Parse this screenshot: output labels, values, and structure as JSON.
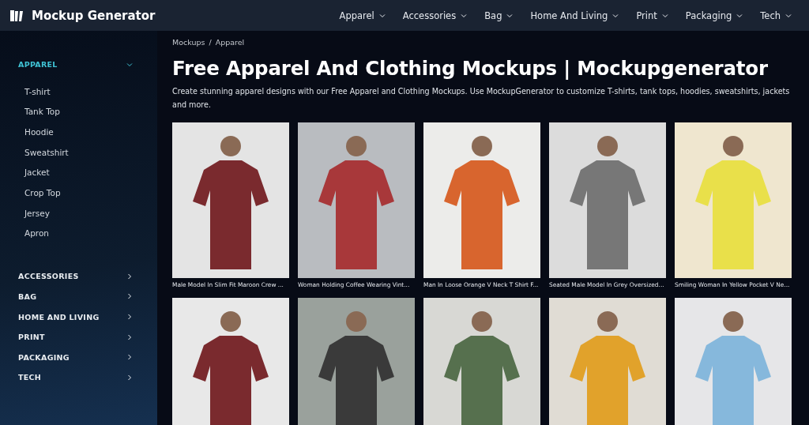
{
  "header": {
    "logo": "Mockup Generator",
    "nav": [
      "Apparel",
      "Accessories",
      "Bag",
      "Home And Living",
      "Print",
      "Packaging",
      "Tech"
    ]
  },
  "sidebar": {
    "categories": [
      {
        "label": "APPAREL",
        "expanded": true,
        "children": [
          {
            "label": "T-shirt"
          },
          {
            "label": "Tank Top"
          },
          {
            "label": "Hoodie"
          },
          {
            "label": "Sweatshirt"
          },
          {
            "label": "Jacket"
          },
          {
            "label": "Crop Top"
          },
          {
            "label": "Jersey"
          },
          {
            "label": "Apron"
          }
        ]
      },
      {
        "label": "ACCESSORIES",
        "expanded": false
      },
      {
        "label": "BAG",
        "expanded": false
      },
      {
        "label": "HOME AND LIVING",
        "expanded": false
      },
      {
        "label": "PRINT",
        "expanded": false
      },
      {
        "label": "PACKAGING",
        "expanded": false
      },
      {
        "label": "TECH",
        "expanded": false
      }
    ]
  },
  "breadcrumb": {
    "separator": "/",
    "items": [
      "Mockups",
      "Apparel"
    ]
  },
  "title": "Free Apparel And Clothing Mockups | Mockupgenerator",
  "description": "Create stunning apparel designs with our Free Apparel and Clothing Mockups. Use MockupGenerator to customize T-shirts, tank tops, hoodies, sweatshirts, jackets and more.",
  "mockups": [
    {
      "kind": "photo",
      "caption": "Male Model In Slim Fit Maroon Crew ..."
    },
    {
      "kind": "photo",
      "caption": "Woman Holding Coffee Wearing Vint..."
    },
    {
      "kind": "photo",
      "caption": "Man In Loose Orange V Neck T Shirt F..."
    },
    {
      "kind": "photo",
      "caption": "Seated Male Model In Grey Oversized..."
    },
    {
      "kind": "photo",
      "caption": "Smiling Woman In Yellow Pocket V Ne..."
    },
    {
      "kind": "photo"
    },
    {
      "kind": "photo"
    },
    {
      "kind": "photo"
    },
    {
      "kind": "photo"
    },
    {
      "kind": "photo"
    }
  ]
}
